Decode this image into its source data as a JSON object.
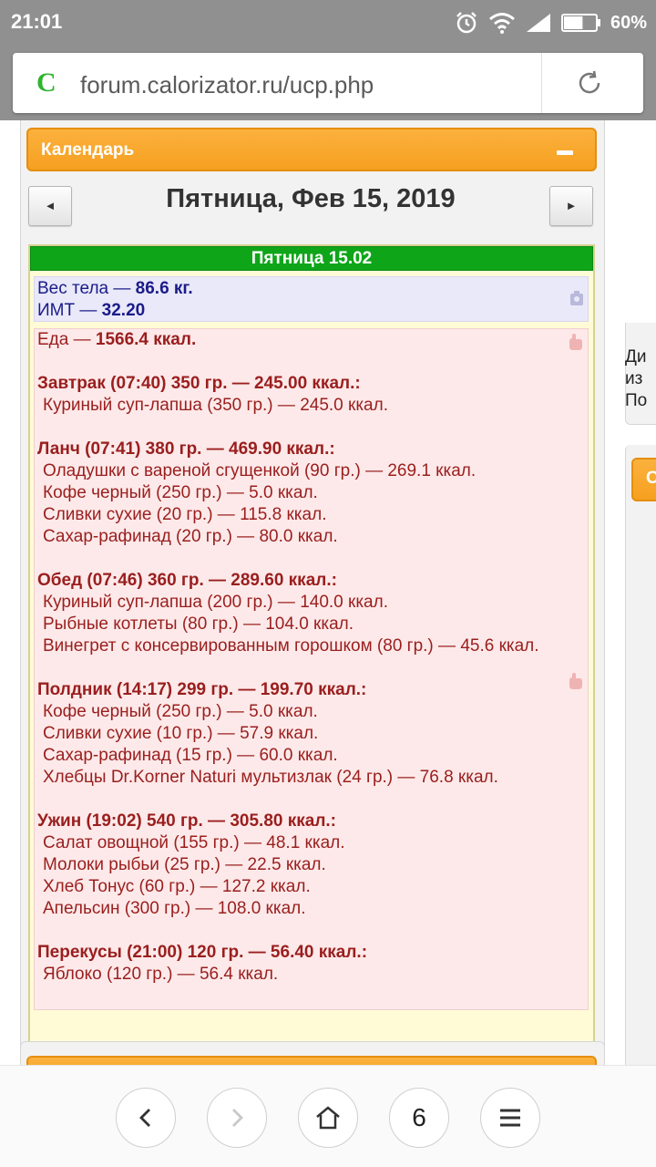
{
  "status_bar": {
    "time": "21:01",
    "battery_percent": "60%",
    "battery_level": 0.6,
    "icons": [
      "alarm-icon",
      "wifi-icon",
      "signal-icon",
      "battery-icon"
    ]
  },
  "browser": {
    "site_badge": "C",
    "url": "forum.calorizator.ru/ucp.php",
    "icons": [
      "reload-icon"
    ]
  },
  "calendar": {
    "header_title": "Календарь",
    "prev_label": "◄",
    "next_label": "►",
    "date_title": "Пятница, Фев 15, 2019",
    "day_header": "Пятница 15.02"
  },
  "body_metrics": {
    "weight_label": "Вес тела — ",
    "weight_value": "86.6 кг.",
    "bmi_label": "ИМТ — ",
    "bmi_value": "32.20"
  },
  "food": {
    "total_label": "Еда — ",
    "total_value": "1566.4 ккал.",
    "meals": [
      {
        "title": "Завтрак (07:40) 350 гр. — 245.00 ккал.:",
        "items": [
          "Куриный суп-лапша (350 гр.) — 245.0 ккал."
        ]
      },
      {
        "title": "Ланч (07:41) 380 гр. — 469.90 ккал.:",
        "items": [
          "Оладушки с вареной сгущенкой (90 гр.) — 269.1 ккал.",
          "Кофе черный (250 гр.) — 5.0 ккал.",
          "Сливки сухие (20 гр.) — 115.8 ккал.",
          "Сахар-рафинад (20 гр.) — 80.0 ккал."
        ]
      },
      {
        "title": "Обед (07:46) 360 гр. — 289.60 ккал.:",
        "items": [
          "Куриный суп-лапша (200 гр.) — 140.0 ккал.",
          "Рыбные котлеты (80 гр.) — 104.0 ккал.",
          "Винегрет с консервированным горошком (80 гр.) — 45.6 ккал."
        ]
      },
      {
        "title": "Полдник (14:17) 299 гр. — 199.70 ккал.:",
        "items": [
          "Кофе черный (250 гр.) — 5.0 ккал.",
          "Сливки сухие (10 гр.) — 57.9 ккал.",
          "Сахар-рафинад (15 гр.) — 60.0 ккал.",
          "Хлебцы Dr.Korner Naturi мультизлак (24 гр.) — 76.8 ккал."
        ]
      },
      {
        "title": "Ужин (19:02) 540 гр. — 305.80 ккал.:",
        "items": [
          "Салат овощной (155 гр.) — 48.1 ккал.",
          "Молоки рыбьи (25 гр.) — 22.5 ккал.",
          "Хлеб Тонус (60 гр.) — 127.2 ккал.",
          "Апельсин (300 гр.) — 108.0 ккал."
        ]
      },
      {
        "title": "Перекусы (21:00) 120 гр. — 56.40 ккал.:",
        "items": [
          "Яблоко (120 гр.) — 56.4 ккал."
        ]
      }
    ]
  },
  "side_clipped": {
    "lines": [
      "Ди",
      "из",
      "По"
    ],
    "orange_label": "О"
  },
  "bottom_nav": {
    "tab_count": "6",
    "icons": [
      "back-icon",
      "forward-icon",
      "home-icon",
      "tabs-icon",
      "menu-icon"
    ]
  }
}
